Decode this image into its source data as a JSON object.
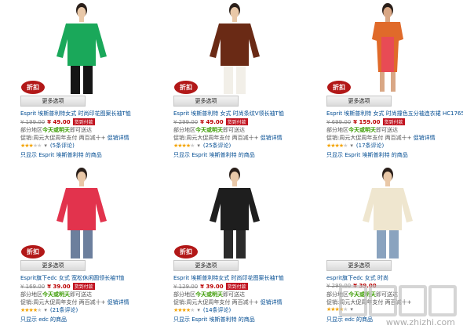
{
  "products": [
    {
      "badge": "折扣",
      "more_options": "更多选项",
      "title": "Esprit 埃斯普利特女式 时尚印花图案长袖T恤",
      "old_price": "¥ 199.00",
      "new_price": "¥ 49.00",
      "tag": "货到付款",
      "shipping_prefix": "部分地区",
      "shipping_bold": "今天或明天",
      "shipping_suffix": "即可送达",
      "promo_prefix": "促销:",
      "promo_text": "周元大促周年支付 两百减十+",
      "promo_link": "促销详情",
      "stars": 3,
      "reviews": "(5条评论)",
      "only_show": "只显示 Esprit 埃斯普利特 的商品",
      "colors": {
        "top": "#1aa85a",
        "bottom": "#151515",
        "skin": "#e9c8a8"
      }
    },
    {
      "badge": "折扣",
      "more_options": "更多选项",
      "title": "Esprit 埃斯普利特 女式 时尚条纹V领长袖T恤",
      "old_price": "¥ 299.00",
      "new_price": "¥ 49.00",
      "tag": "货到付款",
      "shipping_prefix": "部分地区",
      "shipping_bold": "今天或明天",
      "shipping_suffix": "即可送达",
      "promo_prefix": "促销:",
      "promo_text": "周元大促周年支付 两百减十+",
      "promo_link": "促销详情",
      "stars": 4,
      "reviews": "(25条评论)",
      "only_show": "只显示 Esprit 埃斯普利特 的商品",
      "colors": {
        "top": "#6a2a15",
        "bottom": "#f2efe8",
        "skin": "#e9c8a8"
      }
    },
    {
      "badge": "折扣",
      "more_options": "更多选项",
      "title": "Esprit 埃斯普利特 女式 时尚撞色五分袖连衣裙 HC1765",
      "old_price": "¥ 699.00",
      "new_price": "¥ 159.00",
      "tag": "货到付款",
      "shipping_prefix": "部分地区",
      "shipping_bold": "今天或明天",
      "shipping_suffix": "即可送达",
      "promo_prefix": "促销:",
      "promo_text": "周元大促周年支付 两百减十+",
      "promo_link": "促销详情",
      "stars": 4,
      "reviews": "(17条评论)",
      "only_show": "只显示 Esprit 埃斯普利特 的商品",
      "colors": {
        "top": "#e06a2a",
        "bottom": "#e84b55",
        "skin": "#d9a785"
      }
    },
    {
      "badge": "折扣",
      "more_options": "更多选项",
      "title": "Esprit旗下edc 女式 宽松休闲圆领长袖T恤",
      "old_price": "¥ 169.00",
      "new_price": "¥ 39.00",
      "tag": "货到付款",
      "shipping_prefix": "部分地区",
      "shipping_bold": "今天或明天",
      "shipping_suffix": "即可送达",
      "promo_prefix": "促销:",
      "promo_text": "周元大促周年支付 两百减十+",
      "promo_link": "促销详情",
      "stars": 4,
      "reviews": "(21条评论)",
      "only_show": "只显示 edc 的商品",
      "colors": {
        "top": "#e2334d",
        "bottom": "#6c7f9d",
        "skin": "#e9c8a8"
      }
    },
    {
      "badge": "折扣",
      "more_options": "更多选项",
      "title": "Esprit 埃斯普利特女式 时尚印花图案长袖T恤",
      "old_price": "¥ 129.00",
      "new_price": "¥ 39.00",
      "tag": "货到付款",
      "shipping_prefix": "部分地区",
      "shipping_bold": "今天或明天",
      "shipping_suffix": "即可送达",
      "promo_prefix": "促销:",
      "promo_text": "周元大促周年支付 两百减十+",
      "promo_link": "促销详情",
      "stars": 4,
      "reviews": "(14条评论)",
      "only_show": "只显示 Esprit 埃斯普利特 的商品",
      "colors": {
        "top": "#1e1e1e",
        "bottom": "#2b2b2b",
        "skin": "#e9c8a8"
      }
    },
    {
      "badge": "",
      "more_options": "更多选项",
      "title": "esprit旗下edc 女式 时尚",
      "old_price": "¥ 299.00",
      "new_price": "¥ 39.00",
      "tag": "",
      "shipping_prefix": "部分地区",
      "shipping_bold": "今天或明天",
      "shipping_suffix": "即可送达",
      "promo_prefix": "促销:",
      "promo_text": "周元大促周年支付 两百减十+",
      "promo_link": "",
      "stars": 4,
      "reviews": "",
      "only_show": "只显示 edc 的商品",
      "colors": {
        "top": "#efe6cf",
        "bottom": "#8aa3bf",
        "skin": "#e9c8a8"
      }
    }
  ],
  "watermark": {
    "text": "www.zhizhi.com"
  }
}
